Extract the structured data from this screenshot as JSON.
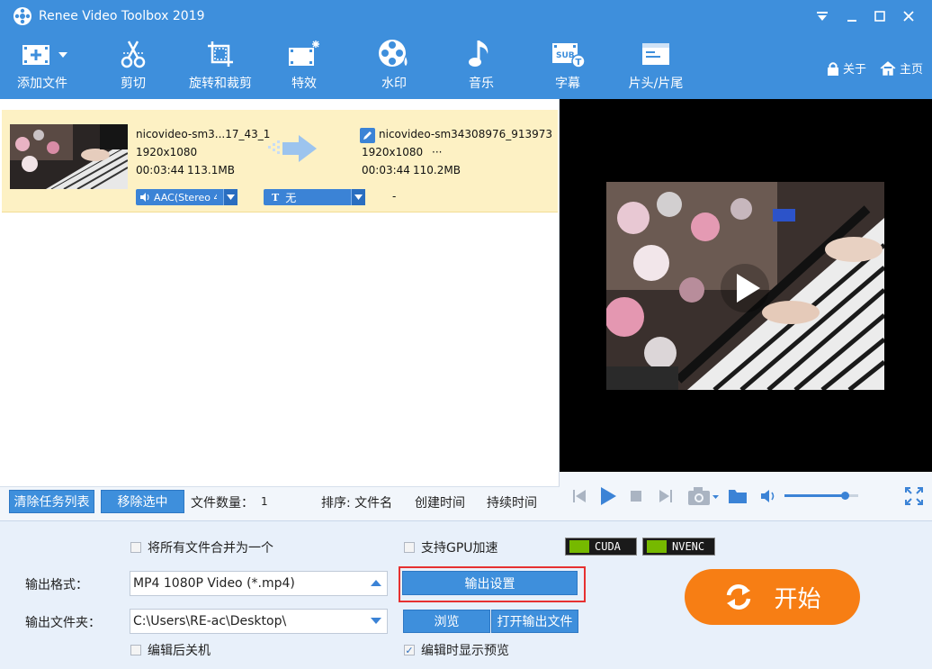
{
  "window": {
    "title": "Renee Video Toolbox 2019",
    "controls": [
      "minimize-menu",
      "minimize",
      "maximize",
      "close"
    ]
  },
  "toolbar": {
    "tools": [
      {
        "label": "添加文件",
        "icon": "add-file-icon"
      },
      {
        "label": "剪切",
        "icon": "scissors-icon"
      },
      {
        "label": "旋转和裁剪",
        "icon": "crop-icon"
      },
      {
        "label": "特效",
        "icon": "effects-icon"
      },
      {
        "label": "水印",
        "icon": "watermark-icon"
      },
      {
        "label": "音乐",
        "icon": "music-icon"
      },
      {
        "label": "字幕",
        "icon": "subtitle-icon"
      },
      {
        "label": "片头/片尾",
        "icon": "intro-outro-icon"
      }
    ],
    "about": "关于",
    "home": "主页"
  },
  "file": {
    "src_name": "nicovideo-sm3...17_43_1",
    "src_resolution": "1920x1080",
    "src_duration": "00:03:44",
    "src_size": "113.1MB",
    "dst_name": "nicovideo-sm34308976_913973",
    "dst_resolution": "1920x1080",
    "dst_more": "···",
    "dst_duration": "00:03:44",
    "dst_size": "110.2MB",
    "audio_track": "AAC(Stereo 4",
    "subtitle": "无",
    "subtitle_icon_text": "T",
    "extra": "-"
  },
  "list_footer": {
    "clear_button": "清除任务列表",
    "remove_button": "移除选中",
    "file_count_label": "文件数量：",
    "file_count": "1",
    "sort_label": "排序: 文件名",
    "sort_created": "创建时间",
    "sort_duration": "持续时间"
  },
  "player": {
    "volume": 0.82
  },
  "settings": {
    "merge_label": "将所有文件合并为一个",
    "merge_checked": false,
    "gpu_label": "支持GPU加速",
    "gpu_checked": false,
    "cuda": "CUDA",
    "nvenc": "NVENC",
    "format_label": "输出格式：",
    "format_value": "MP4 1080P Video (*.mp4)",
    "output_settings_button": "输出设置",
    "folder_label": "输出文件夹：",
    "folder_value": "C:\\Users\\RE-ac\\Desktop\\",
    "browse_button": "浏览",
    "open_folder_button": "打开输出文件",
    "shutdown_label": "编辑后关机",
    "shutdown_checked": false,
    "preview_label": "编辑时显示预览",
    "preview_checked": true,
    "start_button": "开始"
  },
  "colors": {
    "accent": "#3e8fdc",
    "highlight_row": "#fdf1c4",
    "start": "#f77e14",
    "callout": "#e63131"
  }
}
